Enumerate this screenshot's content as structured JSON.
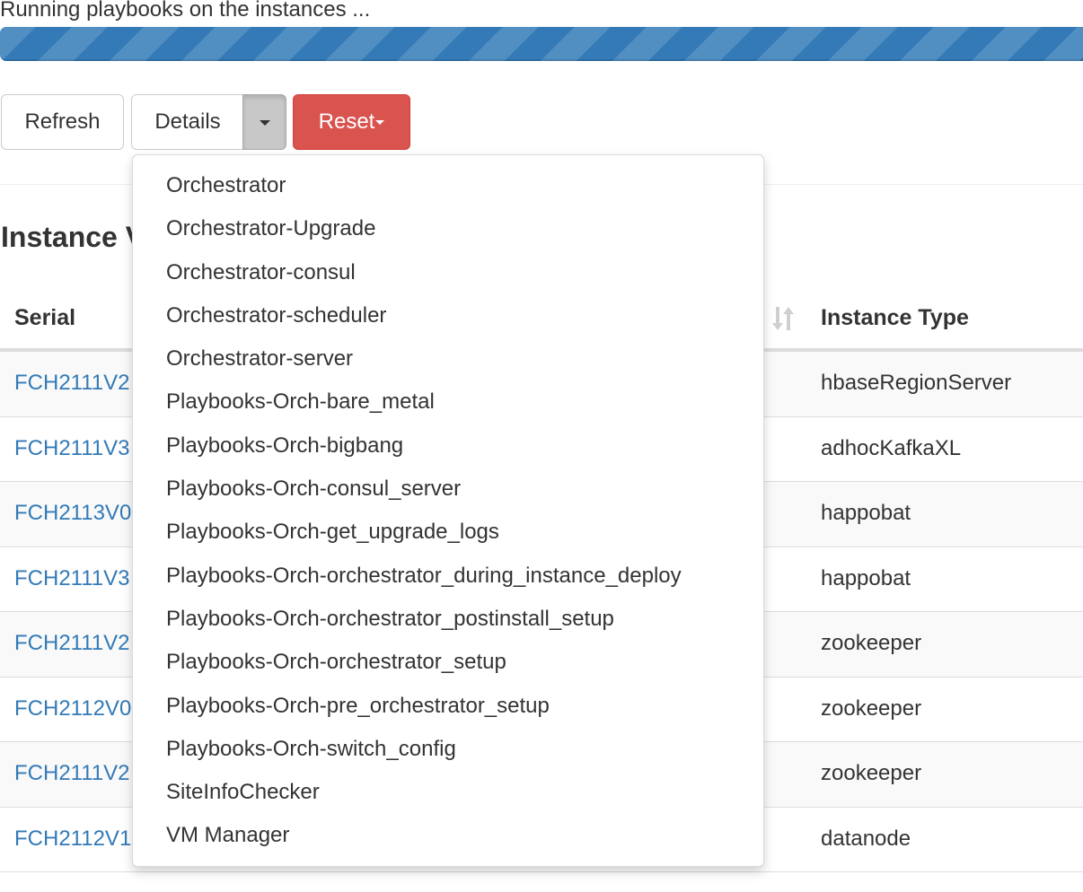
{
  "status": {
    "message": "Running playbooks on the instances ...",
    "progress_percent": 100,
    "progress_style": "striped-animated",
    "progress_color": "#337ab7"
  },
  "toolbar": {
    "refresh_label": "Refresh",
    "details_label": "Details",
    "details_caret_icon": "caret-down-icon",
    "reset_label": "Reset",
    "reset_color": "#d9534f"
  },
  "section": {
    "title": "Instance V"
  },
  "table": {
    "columns": [
      {
        "label": "Serial"
      },
      {
        "label": "Instance Type",
        "sort_icon": "sort-icon"
      }
    ],
    "rows": [
      {
        "serial": "FCH2111V2",
        "type": "hbaseRegionServer"
      },
      {
        "serial": "FCH2111V3",
        "type": "adhocKafkaXL"
      },
      {
        "serial": "FCH2113V0",
        "type": "happobat"
      },
      {
        "serial": "FCH2111V3",
        "type": "happobat"
      },
      {
        "serial": "FCH2111V2",
        "type": "zookeeper"
      },
      {
        "serial": "FCH2112V0",
        "type": "zookeeper"
      },
      {
        "serial": "FCH2111V2",
        "type": "zookeeper"
      },
      {
        "serial": "FCH2112V1",
        "type": "datanode"
      }
    ]
  },
  "details_menu": {
    "items": [
      "Orchestrator",
      "Orchestrator-Upgrade",
      "Orchestrator-consul",
      "Orchestrator-scheduler",
      "Orchestrator-server",
      "Playbooks-Orch-bare_metal",
      "Playbooks-Orch-bigbang",
      "Playbooks-Orch-consul_server",
      "Playbooks-Orch-get_upgrade_logs",
      "Playbooks-Orch-orchestrator_during_instance_deploy",
      "Playbooks-Orch-orchestrator_postinstall_setup",
      "Playbooks-Orch-orchestrator_setup",
      "Playbooks-Orch-pre_orchestrator_setup",
      "Playbooks-Orch-switch_config",
      "SiteInfoChecker",
      "VM Manager"
    ]
  }
}
